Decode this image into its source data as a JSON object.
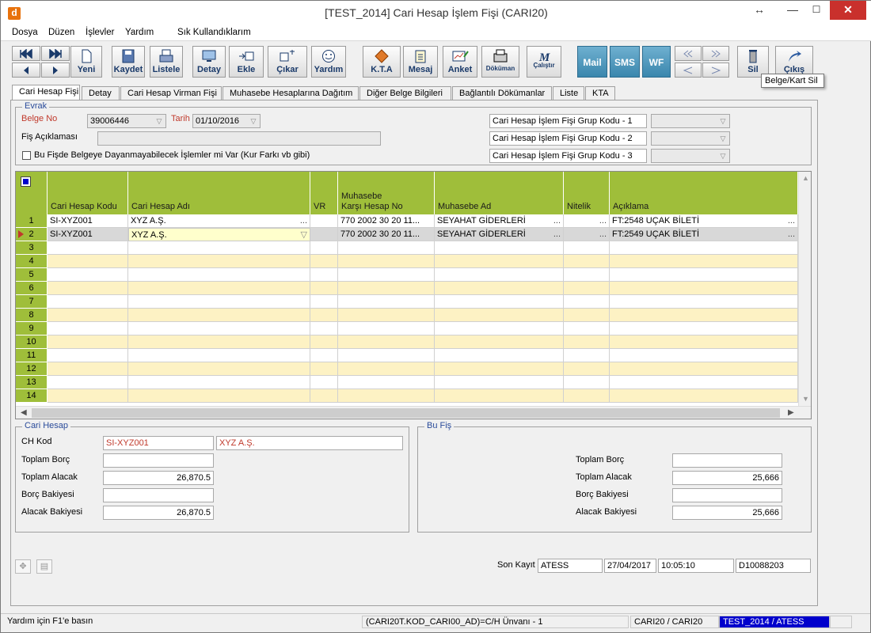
{
  "window": {
    "title": "[TEST_2014] Cari Hesap İşlem Fişi (CARI20)",
    "icon_letter": "d",
    "restore_glyph": "↔",
    "min_glyph": "—",
    "max_glyph": "☐",
    "close_glyph": "✕"
  },
  "menu": [
    {
      "label": "Dosya"
    },
    {
      "label": "Düzen"
    },
    {
      "label": "İşlevler"
    },
    {
      "label": "Yardım"
    },
    {
      "label": "Sık Kullandıklarım"
    }
  ],
  "toolbar": {
    "first": "",
    "last": "",
    "prev": "",
    "next": "",
    "yeni": "Yeni",
    "kaydet": "Kaydet",
    "listele": "Listele",
    "detay": "Detay",
    "ekle": "Ekle",
    "cikar": "Çıkar",
    "yardim": "Yardım",
    "kta": "K.T.A",
    "mesaj": "Mesaj",
    "anket": "Anket",
    "dokuman": "Döküman",
    "calistir": "Çalıştır",
    "mail": "Mail",
    "sms": "SMS",
    "wf": "WF",
    "sil": "Sil",
    "cikis": "Çıkış"
  },
  "tooltip": "Belge/Kart Sil",
  "tabs": [
    "Cari Hesap Fişi",
    "Detay",
    "Cari Hesap Virman Fişi",
    "Muhasebe Hesaplarına Dağıtım",
    "Diğer Belge Bilgileri",
    "Bağlantılı Dökümanlar",
    "Liste",
    "KTA"
  ],
  "evrak": {
    "legend": "Evrak",
    "belge_no_label": "Belge No",
    "belge_no": "39006446",
    "tarih_label": "Tarih",
    "tarih": "01/10/2016",
    "fis_aciklamasi_label": "Fiş Açıklaması",
    "fis_aciklamasi": "",
    "checkbox_label": "Bu Fişde Belgeye Dayanmayabilecek İşlemler mi Var (Kur Farkı vb gibi)",
    "grup1": "Cari Hesap İşlem Fişi Grup Kodu - 1",
    "grup2": "Cari Hesap İşlem Fişi Grup Kodu - 2",
    "grup3": "Cari Hesap İşlem Fişi Grup Kodu - 3"
  },
  "grid": {
    "headers": {
      "kod": "Cari Hesap Kodu",
      "adi": "Cari Hesap Adı",
      "vr": "VR",
      "karsi1": "Muhasebe",
      "karsi2": "Karşı Hesap No",
      "muh_ad": "Muhasebe Ad",
      "nitelik": "Nitelik",
      "aciklama": "Açıklama"
    },
    "rows": [
      {
        "n": "1",
        "kod": "SI-XYZ001",
        "adi": "XYZ A.Ş.",
        "adi_dots": "...",
        "karsi": "770 2002 30 20 11...",
        "muh_ad": "SEYAHAT GİDERLERİ",
        "muh_dots": "...",
        "nitelik_dots": "...",
        "aciklama": "FT:2548 UÇAK BİLETİ",
        "ac_dots": "..."
      },
      {
        "n": "2",
        "kod": "SI-XYZ001",
        "adi": "XYZ A.Ş.",
        "adi_dots": "",
        "karsi": "770 2002 30 20 11...",
        "muh_ad": "SEYAHAT GİDERLERİ",
        "muh_dots": "...",
        "nitelik_dots": "...",
        "aciklama": "FT:2549 UÇAK BİLETİ",
        "ac_dots": "..."
      },
      {
        "n": "3"
      },
      {
        "n": "4"
      },
      {
        "n": "5"
      },
      {
        "n": "6"
      },
      {
        "n": "7"
      },
      {
        "n": "8"
      },
      {
        "n": "9"
      },
      {
        "n": "10"
      },
      {
        "n": "11"
      },
      {
        "n": "12"
      },
      {
        "n": "13"
      },
      {
        "n": "14"
      }
    ]
  },
  "cari_hesap": {
    "legend": "Cari Hesap",
    "ch_kod_label": "CH Kod",
    "ch_kod": "SI-XYZ001",
    "ch_ad": "XYZ A.Ş.",
    "toplam_borc_label": "Toplam Borç",
    "toplam_borc": "",
    "toplam_alacak_label": "Toplam Alacak",
    "toplam_alacak": "26,870.5",
    "borc_bakiyesi_label": "Borç Bakiyesi",
    "borc_bakiyesi": "",
    "alacak_bakiyesi_label": "Alacak Bakiyesi",
    "alacak_bakiyesi": "26,870.5"
  },
  "bu_fis": {
    "legend": "Bu Fiş",
    "toplam_borc_label": "Toplam Borç",
    "toplam_borc": "",
    "toplam_alacak_label": "Toplam Alacak",
    "toplam_alacak": "25,666",
    "borc_bakiyesi_label": "Borç Bakiyesi",
    "borc_bakiyesi": "",
    "alacak_bakiyesi_label": "Alacak Bakiyesi",
    "alacak_bakiyesi": "25,666"
  },
  "son_kayit": {
    "label": "Son Kayıt",
    "user": "ATESS",
    "date": "27/04/2017",
    "time": "10:05:10",
    "id": "D10088203"
  },
  "status": {
    "help": "Yardım için F1'e basın",
    "field": "(CARI20T.KOD_CARI00_AD)=C/H Ünvanı - 1",
    "form": "CARI20 / CARI20",
    "db": "TEST_2014 / ATESS"
  },
  "colors": {
    "grid_green": "#9fbe3a",
    "row_yellow": "#fdf2c4",
    "status_blue": "#0000cc"
  }
}
